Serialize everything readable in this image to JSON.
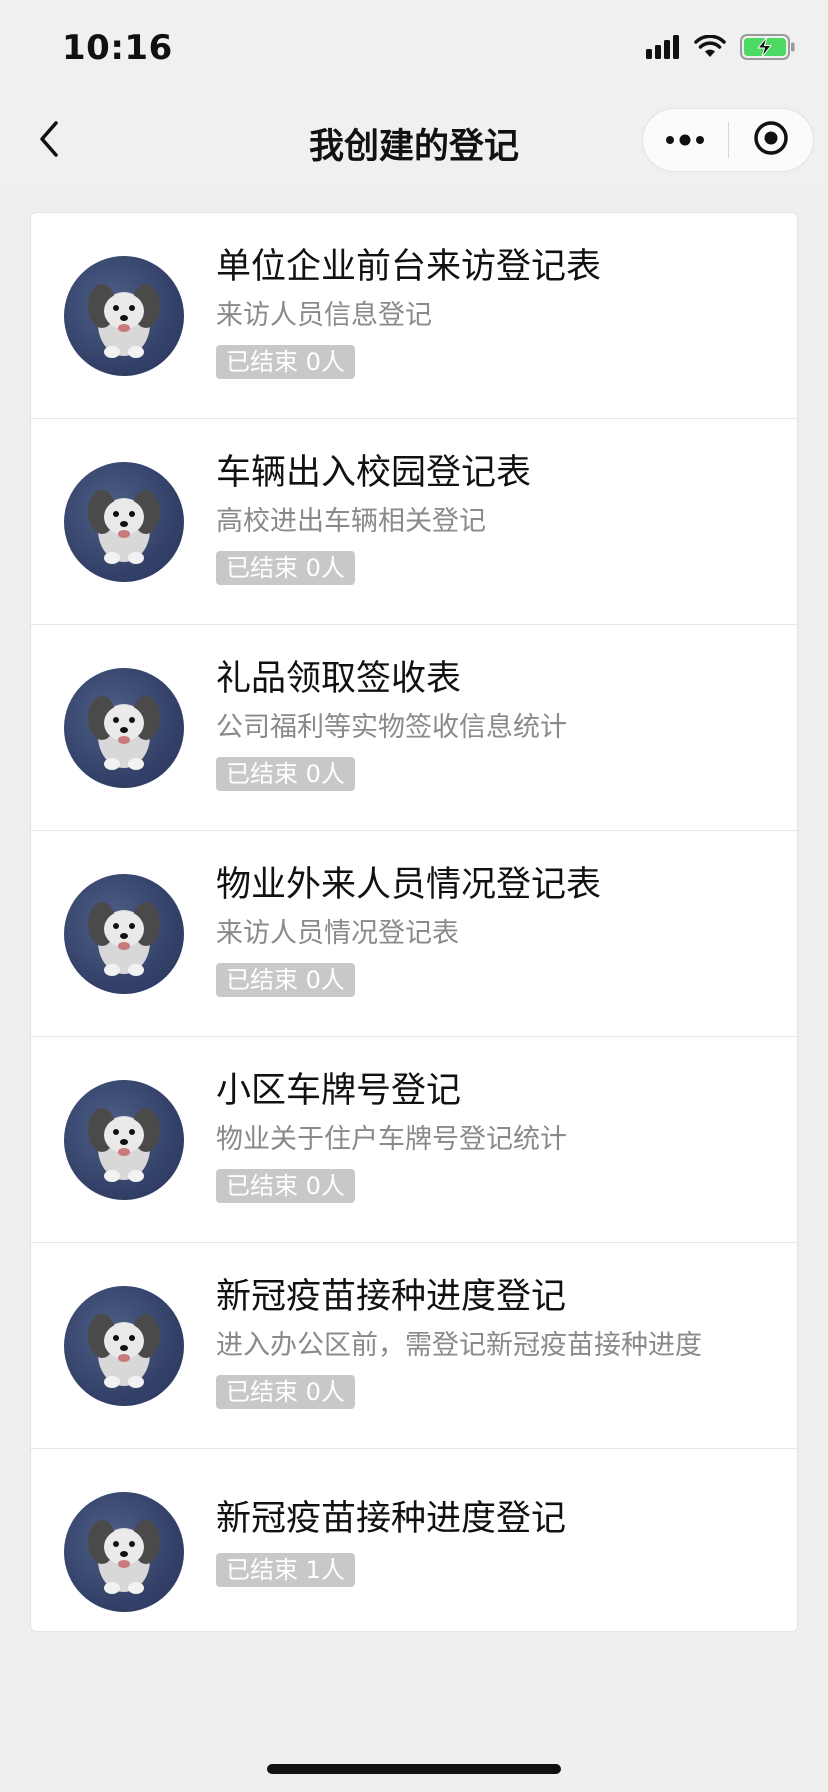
{
  "status_bar": {
    "time": "10:16"
  },
  "nav": {
    "title": "我创建的登记"
  },
  "items": [
    {
      "title": "单位企业前台来访登记表",
      "subtitle": "来访人员信息登记",
      "badge": "已结束 0人"
    },
    {
      "title": "车辆出入校园登记表",
      "subtitle": "高校进出车辆相关登记",
      "badge": "已结束 0人"
    },
    {
      "title": "礼品领取签收表",
      "subtitle": "公司福利等实物签收信息统计",
      "badge": "已结束 0人"
    },
    {
      "title": "物业外来人员情况登记表",
      "subtitle": "来访人员情况登记表",
      "badge": "已结束 0人"
    },
    {
      "title": "小区车牌号登记",
      "subtitle": "物业关于住户车牌号登记统计",
      "badge": "已结束 0人"
    },
    {
      "title": "新冠疫苗接种进度登记",
      "subtitle": "进入办公区前，需登记新冠疫苗接种进度",
      "badge": "已结束 0人"
    },
    {
      "title": "新冠疫苗接种进度登记",
      "badge": "已结束 1人"
    }
  ],
  "icons": {
    "back": "chevron-left-icon",
    "more": "more-dots-icon",
    "close": "mini-program-close-icon",
    "signal": "cellular-signal-icon",
    "wifi": "wifi-icon",
    "battery": "battery-charging-icon",
    "avatar": "dog-avatar-image"
  },
  "colors": {
    "page_bg": "#efefef",
    "card_bg": "#ffffff",
    "badge_bg": "#c8c8c8",
    "battery_green": "#4cd964",
    "avatar_blue": "#34426a"
  }
}
